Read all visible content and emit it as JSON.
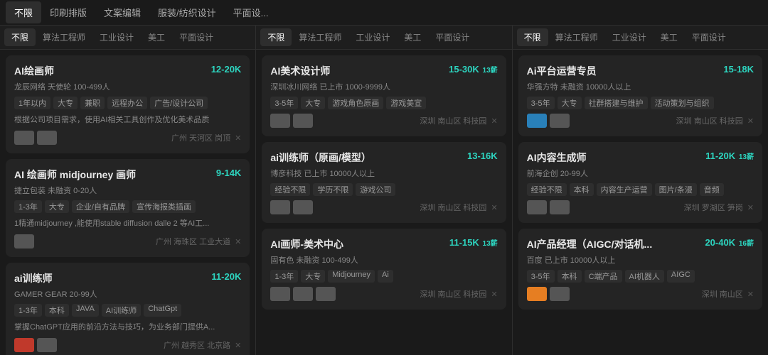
{
  "header_tabs": [
    {
      "label": "不限",
      "active": true
    },
    {
      "label": "印刷排版",
      "active": false
    },
    {
      "label": "文案编辑",
      "active": false
    },
    {
      "label": "服装/纺织设计",
      "active": false
    },
    {
      "label": "平面设...",
      "active": false
    }
  ],
  "columns": [
    {
      "tabs": [
        {
          "label": "不限",
          "active": true
        },
        {
          "label": "算法工程师",
          "active": false
        },
        {
          "label": "工业设计",
          "active": false
        },
        {
          "label": "美工",
          "active": false
        },
        {
          "label": "平面设计",
          "active": false
        }
      ],
      "cards": [
        {
          "title": "AI绘画师",
          "salary": "12-20K",
          "salary_suffix": "",
          "company": "龙辰网络 天使轮 100-499人",
          "tags": [
            "1年以内",
            "大专",
            "兼职",
            "远程办公",
            "广告/设计公司"
          ],
          "desc": "根据公司项目需求，使用AI相关工具创作及优化美术品质",
          "avatars": [
            "gray",
            "gray"
          ],
          "location": "广州 天河区 岗顶"
        },
        {
          "title": "AI 绘画师 midjourney 画师",
          "salary": "9-14K",
          "salary_suffix": "",
          "company": "捷立包装 未融资 0-20人",
          "tags": [
            "1-3年",
            "大专",
            "企业/自有品牌",
            "宣传海报类插画"
          ],
          "desc": "1精通midjourney ,能使用stable diffusion dalle 2 等AI工...",
          "avatars": [
            "gray"
          ],
          "location": "广州 海珠区 工业大道"
        },
        {
          "title": "ai训练师",
          "salary": "11-20K",
          "salary_suffix": "",
          "company": "GAMER GEAR 20-99人",
          "tags": [
            "1-3年",
            "本科",
            "JAVA",
            "AI训练师",
            "ChatGpt"
          ],
          "desc": "掌握ChatGPT应用的前沿方法与技巧，为业务部门提供A...",
          "avatars": [
            "red",
            "gray"
          ],
          "location": "广州 越秀区 北京路"
        }
      ]
    },
    {
      "tabs": [
        {
          "label": "不限",
          "active": true
        },
        {
          "label": "算法工程师",
          "active": false
        },
        {
          "label": "工业设计",
          "active": false
        },
        {
          "label": "美工",
          "active": false
        },
        {
          "label": "平面设计",
          "active": false
        }
      ],
      "cards": [
        {
          "title": "AI美术设计师",
          "salary": "15-30K",
          "salary_suffix": "13薪",
          "company": "深圳冰川网络 已上市 1000-9999人",
          "tags": [
            "3-5年",
            "大专",
            "游戏角色原画",
            "游戏美宣"
          ],
          "desc": "",
          "avatars": [
            "gray",
            "gray"
          ],
          "location": "深圳 南山区 科技园"
        },
        {
          "title": "ai训练师（原画/模型）",
          "salary": "13-16K",
          "salary_suffix": "",
          "company": "博彦科技 已上市 10000人以上",
          "tags": [
            "经验不限",
            "学历不限",
            "游戏公司"
          ],
          "desc": "",
          "avatars": [
            "gray",
            "gray"
          ],
          "location": "深圳 南山区 科技园"
        },
        {
          "title": "AI画师-美术中心",
          "salary": "11-15K",
          "salary_suffix": "13薪",
          "company": "固有色 未融资 100-499人",
          "tags": [
            "1-3年",
            "大专",
            "Midjourney",
            "Ai"
          ],
          "desc": "",
          "avatars": [
            "gray",
            "gray",
            "gray"
          ],
          "location": "深圳 南山区 科技园"
        }
      ]
    },
    {
      "tabs": [
        {
          "label": "不限",
          "active": true
        },
        {
          "label": "算法工程师",
          "active": false
        },
        {
          "label": "工业设计",
          "active": false
        },
        {
          "label": "美工",
          "active": false
        },
        {
          "label": "平面设计",
          "active": false
        }
      ],
      "cards": [
        {
          "title": "Ai平台运营专员",
          "salary": "15-18K",
          "salary_suffix": "",
          "company": "华强方特 未融资 10000人以上",
          "tags": [
            "3-5年",
            "大专",
            "社群搭建与维护",
            "活动策划与组织"
          ],
          "desc": "",
          "avatars": [
            "blue",
            "gray"
          ],
          "location": "深圳 南山区 科技园"
        },
        {
          "title": "AI内容生成师",
          "salary": "11-20K",
          "salary_suffix": "13薪",
          "company": "前海企创 20-99人",
          "tags": [
            "经验不限",
            "本科",
            "内容生产运营",
            "图片/条漫",
            "音频"
          ],
          "desc": "",
          "avatars": [
            "gray",
            "gray"
          ],
          "location": "深圳 罗湖区 笋岗"
        },
        {
          "title": "AI产品经理（AIGC/对话机...",
          "salary": "20-40K",
          "salary_suffix": "16薪",
          "company": "百度 已上市 10000人以上",
          "tags": [
            "3-5年",
            "本科",
            "C端产品",
            "AI机器人",
            "AIGC"
          ],
          "desc": "",
          "avatars": [
            "orange",
            "gray"
          ],
          "location": "深圳 南山区"
        }
      ]
    }
  ]
}
